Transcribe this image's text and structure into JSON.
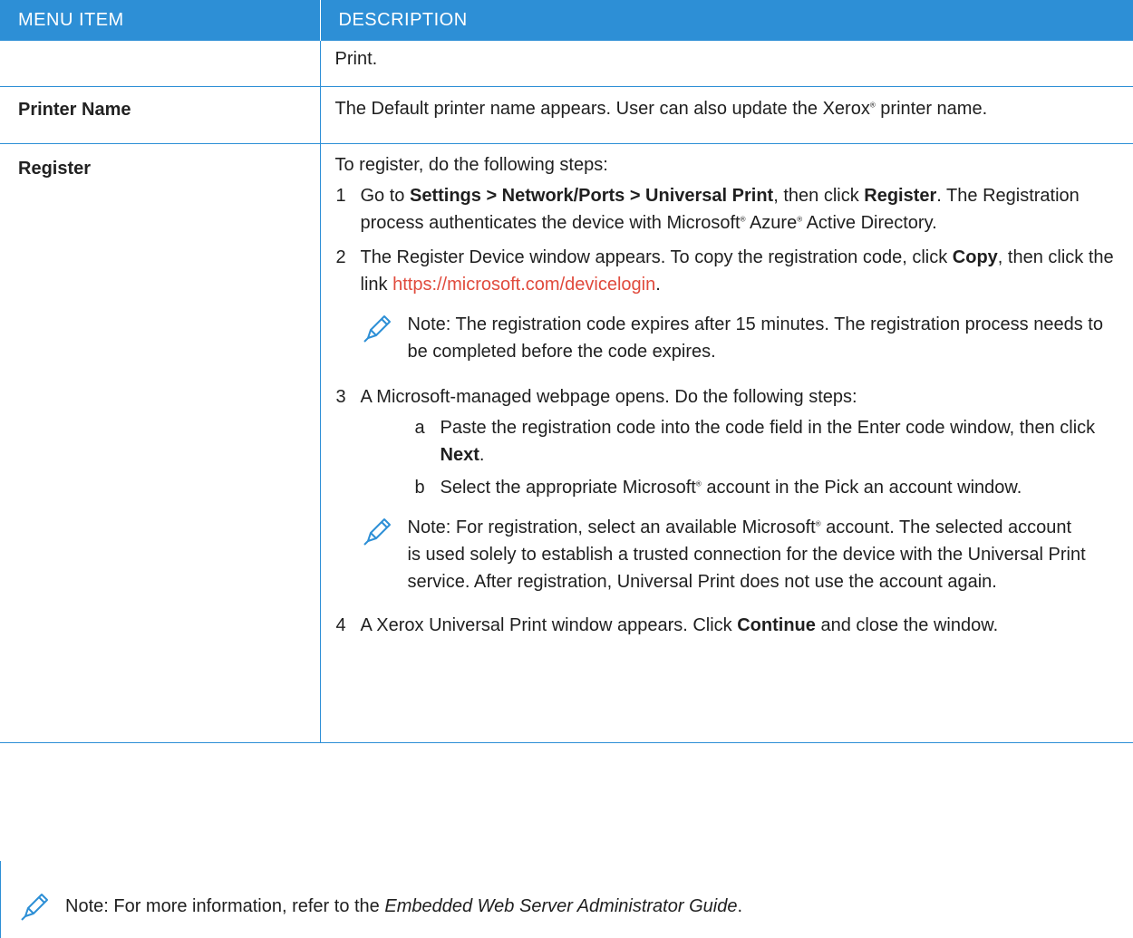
{
  "header": {
    "col1": "MENU ITEM",
    "col2": "DESCRIPTION"
  },
  "rows": {
    "print": {
      "item": "",
      "desc": "Print."
    },
    "printer_name": {
      "item": "Printer Name",
      "desc_a": "The Default printer name appears. User can also update the Xerox",
      "desc_b": " printer name."
    },
    "register": {
      "item": "Register",
      "intro": "To register, do the following steps:",
      "step1": {
        "num": "1",
        "t1": "Go to ",
        "b1": "Settings > Network/Ports > Universal Print",
        "t2": ", then click ",
        "b2": "Register",
        "t3": ". The Registration process authenticates the device with Microsoft",
        "t4": " Azure",
        "t5": " Active Directory."
      },
      "step2": {
        "num": "2",
        "t1": "The Register Device window appears. To copy the registration code, click ",
        "b1": "Copy",
        "t2": ", then click the link ",
        "link": "https://microsoft.com/devicelogin",
        "t3": "."
      },
      "note1": "Note: The registration code expires after 15 minutes. The registration process needs to be completed before the code expires.",
      "step3": {
        "num": "3",
        "text": "A Microsoft-managed webpage opens. Do the following steps:",
        "a": {
          "num": "a",
          "t1": "Paste the registration code into the code field in the Enter code window, then click ",
          "b1": "Next",
          "t2": "."
        },
        "b": {
          "num": "b",
          "t1": "Select the appropriate Microsoft",
          "t2": " account in the Pick an account window."
        }
      },
      "note2": {
        "t1": "Note: For registration, select an available Microsoft",
        "t2": " account. The selected account is used solely to establish a trusted connection for the device with the Universal Print service. After registration, Universal Print does not use the account again."
      },
      "step4": {
        "num": "4",
        "t1": "A Xerox Universal Print window appears. Click ",
        "b1": "Continue",
        "t2": " and close the window."
      }
    }
  },
  "footer_note": {
    "t1": "Note: For more information, refer to the ",
    "italic": "Embedded Web Server Administrator Guide",
    "t2": "."
  },
  "symbols": {
    "registered": "®"
  },
  "icons": {
    "note": "pencil-icon"
  },
  "colors": {
    "header_bg": "#2d8fd6",
    "link": "#e04a3c",
    "border": "#2d8fd6"
  }
}
